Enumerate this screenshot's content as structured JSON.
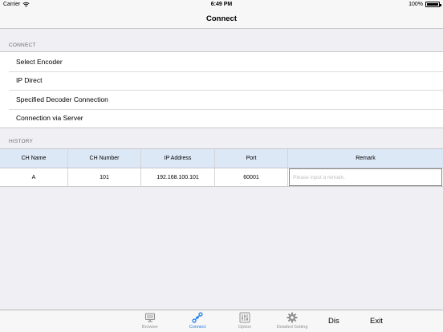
{
  "status_bar": {
    "carrier": "Carrier",
    "time": "6:49 PM",
    "battery": "100%"
  },
  "nav": {
    "title": "Connect"
  },
  "connect_section": {
    "header": "CONNECT",
    "items": [
      {
        "label": "Select Encoder"
      },
      {
        "label": "IP Direct"
      },
      {
        "label": "Specified Decoder Connection"
      },
      {
        "label": "Connection via Server"
      }
    ]
  },
  "history_section": {
    "header": "HISTORY",
    "columns": [
      "CH Name",
      "CH Number",
      "IP Address",
      "Port",
      "Remark"
    ],
    "rows": [
      {
        "ch_name": "A",
        "ch_number": "101",
        "ip_address": "192.168.100.101",
        "port": "60001",
        "remark_value": "",
        "remark_placeholder": "Please input a remark."
      }
    ]
  },
  "tab_bar": {
    "tabs": [
      {
        "label": "Browser",
        "icon": "monitor-icon",
        "active": false
      },
      {
        "label": "Connect",
        "icon": "link-icon",
        "active": true
      },
      {
        "label": "Option",
        "icon": "sliders-icon",
        "active": false
      },
      {
        "label": "Detailed Setting",
        "icon": "gear-icon",
        "active": false
      }
    ],
    "dis_label": "Dis",
    "exit_label": "Exit"
  },
  "colors": {
    "background": "#efeff4",
    "header_row": "#dde8f7",
    "active_tab": "#1a7be6",
    "inactive_tab": "#929292"
  }
}
